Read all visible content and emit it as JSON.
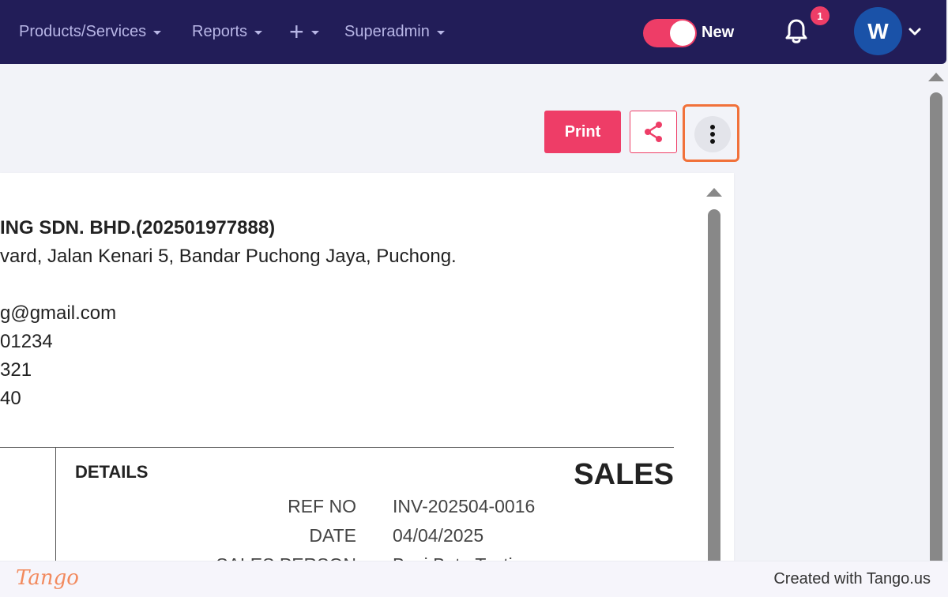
{
  "nav": {
    "items": [
      {
        "label": "Products/Services"
      },
      {
        "label": "Reports"
      },
      {
        "label": "Superadmin"
      }
    ],
    "new_toggle_label": "New",
    "notification_count": "1",
    "avatar_initial": "W",
    "icons": [
      "plus-icon",
      "bell-icon",
      "chevron-down-icon"
    ]
  },
  "toolbar": {
    "print_label": "Print",
    "share_icon": "share-icon",
    "more_icon": "more-vertical-icon"
  },
  "document": {
    "company_name": "ING SDN. BHD.(202501977888)",
    "address": "vard, Jalan Kenari 5, Bandar Puchong Jaya, Puchong.",
    "email": "g@gmail.com",
    "phone_1": "01234",
    "phone_2": "321",
    "phone_3": "40",
    "details_heading": "DETAILS",
    "sales_heading": "SALES",
    "meta": [
      {
        "label": "REF NO",
        "value": "INV-202504-0016"
      },
      {
        "label": "DATE",
        "value": "04/04/2025"
      },
      {
        "label": "SALES PERSON",
        "value": "Bazi Beta Testing"
      }
    ]
  },
  "footer": {
    "logo_text": "Tango",
    "credit": "Created with Tango.us"
  },
  "colors": {
    "nav_bg": "#221d58",
    "accent": "#ee3d67",
    "highlight": "#f1713a",
    "avatar_bg": "#1a52a8"
  }
}
